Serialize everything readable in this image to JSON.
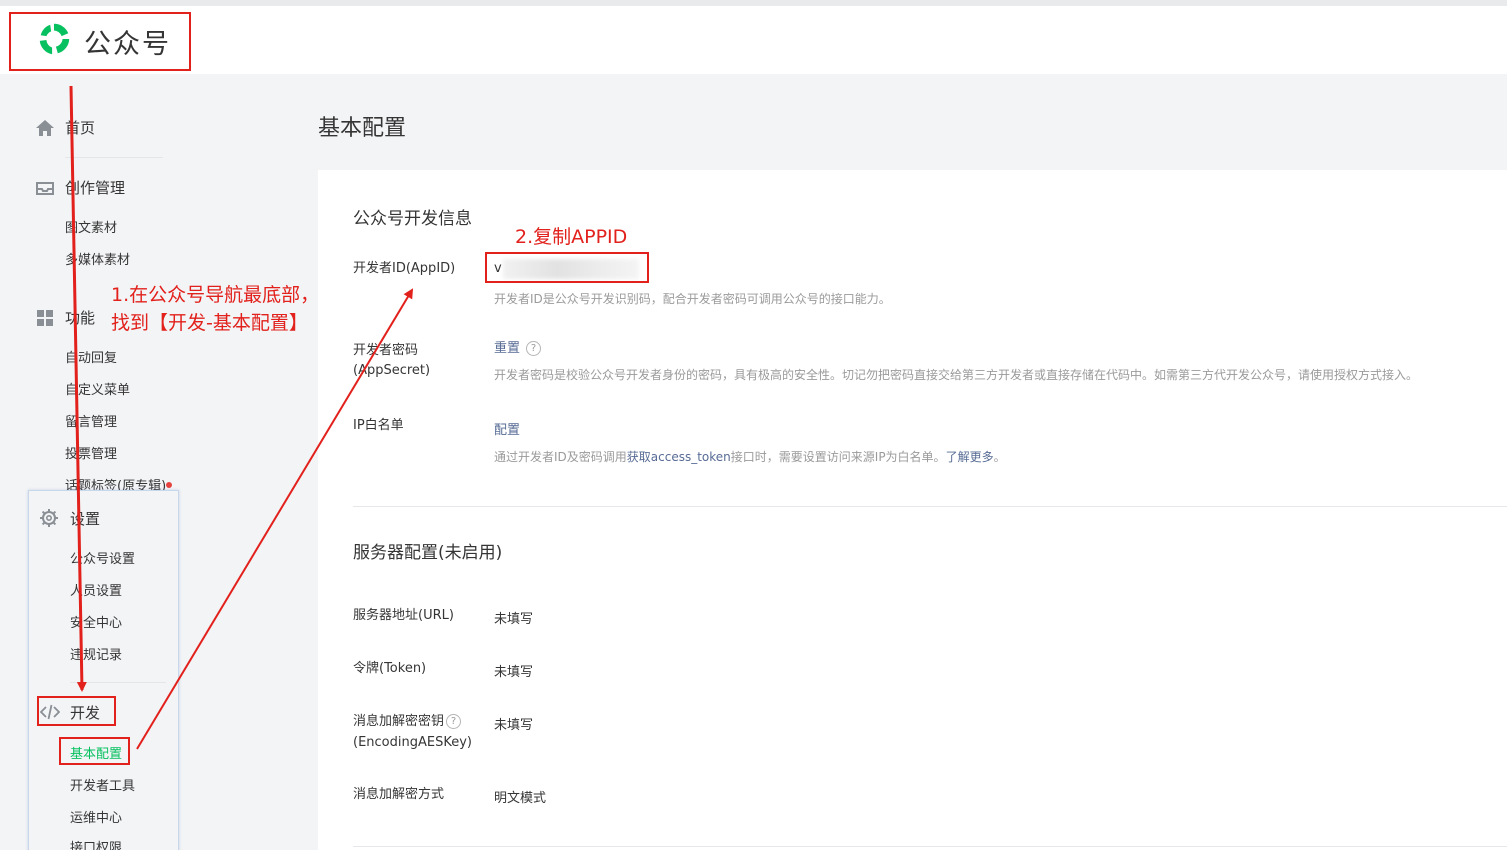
{
  "header": {
    "logo_text": "公众号"
  },
  "sidebar": {
    "home": "首页",
    "creation": {
      "label": "创作管理",
      "items": [
        "图文素材",
        "多媒体素材"
      ]
    },
    "features": {
      "label": "功能",
      "items": [
        "自动回复",
        "自定义菜单",
        "留言管理",
        "投票管理",
        "话题标签(原专辑)"
      ]
    },
    "settings": {
      "label": "设置",
      "items": [
        "公众号设置",
        "人员设置",
        "安全中心",
        "违规记录"
      ]
    },
    "develop": {
      "label": "开发",
      "items": [
        "基本配置",
        "开发者工具",
        "运维中心",
        "接口权限"
      ]
    }
  },
  "page": {
    "title": "基本配置"
  },
  "dev_info": {
    "title": "公众号开发信息",
    "appid_label": "开发者ID(AppID)",
    "appid_value": "v",
    "appid_hint": "开发者ID是公众号开发识别码，配合开发者密码可调用公众号的接口能力。",
    "secret_label": "开发者密码(AppSecret)",
    "secret_action": "重置",
    "secret_hint": "开发者密码是校验公众号开发者身份的密码，具有极高的安全性。切记勿把密码直接交给第三方开发者或直接存储在代码中。如需第三方代开发公众号，请使用授权方式接入。",
    "ip_label": "IP白名单",
    "ip_action": "配置",
    "ip_hint_prefix": "通过开发者ID及密码调用",
    "ip_hint_link": "获取access_token",
    "ip_hint_mid": "接口时，需要设置访问来源IP为白名单。",
    "ip_hint_more": "了解更多",
    "ip_hint_end": "。"
  },
  "server_config": {
    "title": "服务器配置(未启用)",
    "rows": [
      {
        "label": "服务器地址(URL)",
        "value": "未填写"
      },
      {
        "label": "令牌(Token)",
        "value": "未填写"
      },
      {
        "label": "消息加解密密钥",
        "label2": "(EncodingAESKey)",
        "value": "未填写"
      },
      {
        "label": "消息加解密方式",
        "value": "明文模式"
      }
    ]
  },
  "annotations": {
    "step1_line1": "1.在公众号导航最底部，",
    "step1_line2": "找到【开发-基本配置】",
    "step2": "2.复制APPID"
  },
  "colors": {
    "accent_green": "#07c160",
    "annotation_red": "#e2211c",
    "link_blue": "#576b95"
  }
}
